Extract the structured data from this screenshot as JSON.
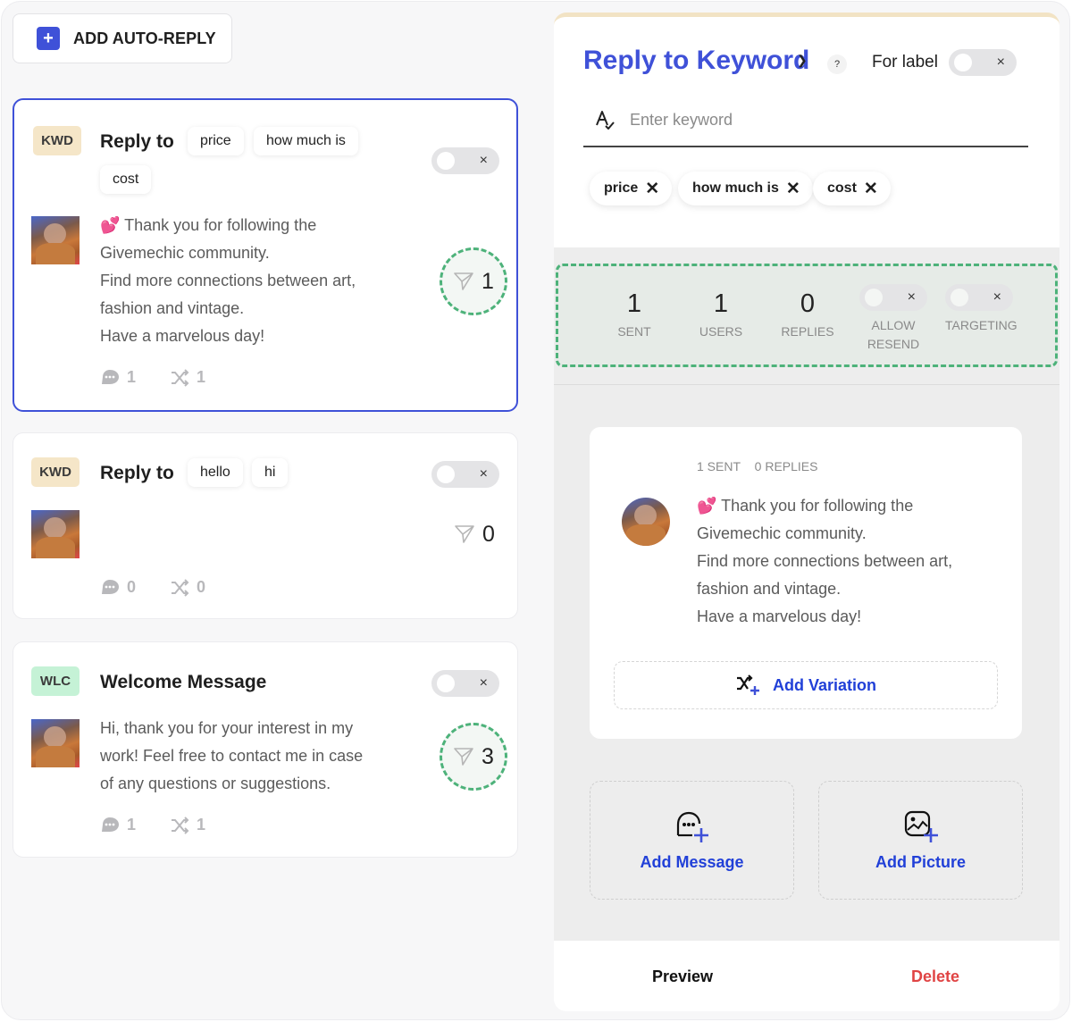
{
  "toolbar": {
    "add_label": "ADD AUTO-REPLY",
    "add_icon": "plus-icon"
  },
  "cards": [
    {
      "badge": "KWD",
      "title": "Reply to",
      "keywords": [
        "price",
        "how much is",
        "cost"
      ],
      "enabled": false,
      "toggle_off_symbol": "×",
      "message_lines": [
        "💕 Thank you for following the",
        "Givemechic community.",
        "Find more connections between art,",
        "fashion and vintage.",
        "Have a marvelous day!"
      ],
      "sent": "1",
      "messages_count": "1",
      "variations_count": "1",
      "selected": true
    },
    {
      "badge": "KWD",
      "title": "Reply to",
      "keywords": [
        "hello",
        "hi"
      ],
      "enabled": false,
      "toggle_off_symbol": "×",
      "message_lines": [],
      "sent": "0",
      "messages_count": "0",
      "variations_count": "0",
      "selected": false
    },
    {
      "badge": "WLC",
      "title": "Welcome Message",
      "keywords": [],
      "enabled": false,
      "toggle_off_symbol": "×",
      "message_lines": [
        "Hi, thank you for your interest in my",
        "work! Feel free to contact me in case",
        "of any questions or suggestions."
      ],
      "sent": "3",
      "messages_count": "1",
      "variations_count": "1",
      "selected": false
    }
  ],
  "panel": {
    "title": "Reply to Keyword",
    "help": "?",
    "for_label": "For label",
    "for_label_enabled": false,
    "keyword_input": {
      "placeholder": "Enter keyword",
      "value": ""
    },
    "keywords": [
      "price",
      "how much is",
      "cost"
    ],
    "remove_symbol": "✕",
    "stats": [
      {
        "value": "1",
        "label": "SENT"
      },
      {
        "value": "1",
        "label": "USERS"
      },
      {
        "value": "0",
        "label": "REPLIES"
      }
    ],
    "allow_resend": {
      "label": "ALLOW RESEND",
      "enabled": false
    },
    "targeting": {
      "label": "TARGETING",
      "enabled": false
    },
    "message": {
      "sent_label": "1 SENT",
      "replies_label": "0 REPLIES",
      "lines": [
        "💕 Thank you for following the",
        "Givemechic community.",
        "Find more connections between art,",
        "fashion and vintage.",
        "Have a marvelous day!"
      ]
    },
    "add_variation": "Add Variation",
    "add_message": "Add Message",
    "add_picture": "Add Picture",
    "preview": "Preview",
    "delete": "Delete"
  },
  "colors": {
    "accent": "#3f51d8",
    "link_blue": "#2140d8",
    "highlight_green": "#4db27a",
    "danger": "#e04444",
    "kwd_badge": "#f5e6c8",
    "wlc_badge": "#c5f2d6"
  }
}
